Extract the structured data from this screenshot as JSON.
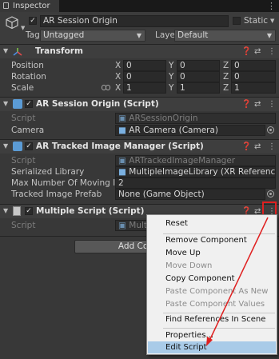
{
  "tab": {
    "label": "Inspector"
  },
  "gameobject": {
    "name": "AR Session Origin",
    "static_label": "Static",
    "tag_label": "Tag",
    "tag_value": "Untagged",
    "layer_label": "Layer",
    "layer_value": "Default"
  },
  "transform": {
    "title": "Transform",
    "rows": [
      {
        "label": "Position",
        "x": "0",
        "y": "0",
        "z": "0"
      },
      {
        "label": "Rotation",
        "x": "0",
        "y": "0",
        "z": "0"
      },
      {
        "label": "Scale",
        "x": "1",
        "y": "1",
        "z": "1"
      }
    ],
    "axis_x": "X",
    "axis_y": "Y",
    "axis_z": "Z"
  },
  "ar_session_origin": {
    "title": "AR Session Origin (Script)",
    "script_label": "Script",
    "script_value": "ARSessionOrigin",
    "camera_label": "Camera",
    "camera_value": "AR Camera (Camera)"
  },
  "ar_tracked": {
    "title": "AR Tracked Image Manager (Script)",
    "script_label": "Script",
    "script_value": "ARTrackedImageManager",
    "library_label": "Serialized Library",
    "library_value": "MultipleImageLibrary (XR Reference Image L",
    "max_label": "Max Number Of Moving Images",
    "max_value": "2",
    "prefab_label": "Tracked Image Prefab",
    "prefab_value": "None (Game Object)"
  },
  "multiple_script": {
    "title": "Multiple Script (Script)",
    "script_label": "Script",
    "script_value": "Multiple"
  },
  "add_component": {
    "label": "Add Comp"
  },
  "context_menu": {
    "items": [
      {
        "label": "Reset",
        "enabled": true
      },
      {
        "label": "Remove Component",
        "enabled": true
      },
      {
        "label": "Move Up",
        "enabled": true
      },
      {
        "label": "Move Down",
        "enabled": false
      },
      {
        "label": "Copy Component",
        "enabled": true
      },
      {
        "label": "Paste Component As New",
        "enabled": false
      },
      {
        "label": "Paste Component Values",
        "enabled": false
      },
      {
        "label": "Find References In Scene",
        "enabled": true
      },
      {
        "label": "Properties...",
        "enabled": true
      },
      {
        "label": "Edit Script",
        "enabled": true,
        "highlighted": true
      }
    ]
  },
  "colors": {
    "highlight_box": "#e02020",
    "arrow": "#e02020",
    "menu_highlight": "#a9cbe8"
  }
}
